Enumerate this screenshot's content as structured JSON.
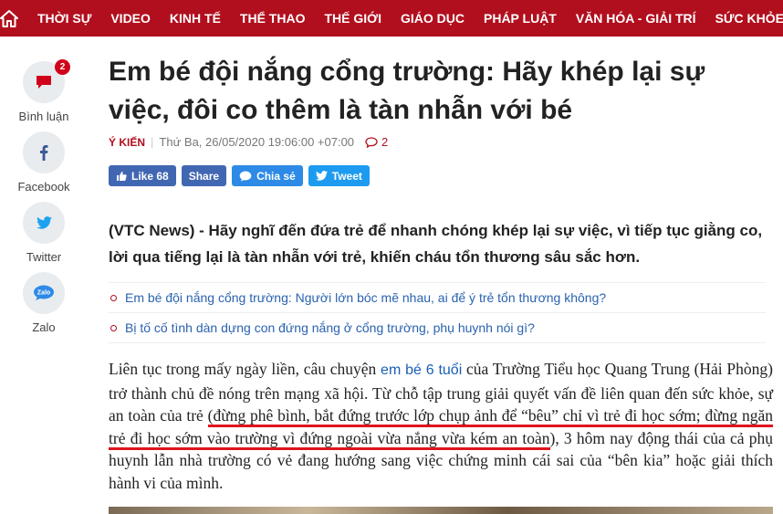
{
  "nav": {
    "items": [
      "THỜI SỰ",
      "VIDEO",
      "KINH TẾ",
      "THỂ THAO",
      "THẾ GIỚI",
      "GIÁO DỤC",
      "PHÁP LUẬT",
      "VĂN HÓA - GIẢI TRÍ",
      "SỨC KHỎE"
    ]
  },
  "rail": {
    "comments_label": "Bình luận",
    "comments_count": "2",
    "facebook_label": "Facebook",
    "twitter_label": "Twitter",
    "zalo_label": "Zalo",
    "zalo_icon_text": "Zalo"
  },
  "article": {
    "title": "Em bé đội nắng cổng trường: Hãy khép lại sự việc, đôi co thêm là tàn nhẫn với bé",
    "category": "Ý KIẾN",
    "datetime": "Thứ Ba, 26/05/2020 19:06:00 +07:00",
    "comment_count": "2",
    "lead": "(VTC News) - Hãy nghĩ đến đứa trẻ để nhanh chóng khép lại sự việc, vì tiếp tục giằng co, lời qua tiếng lại là tàn nhẫn với trẻ, khiến cháu tổn thương sâu sắc hơn.",
    "related": [
      "Em bé đội nắng cổng trường: Người lớn bóc mẽ nhau, ai để ý trẻ tổn thương không?",
      "Bị tố cố tình dàn dựng con đứng nắng ở cổng trường, phụ huynh nói gì?"
    ],
    "body_1": "Liên tục trong mấy ngày liền, câu chuyện ",
    "body_link": "em bé 6 tuổi",
    "body_2": " của Trường Tiểu học Quang Trung (Hải Phòng) trở thành chủ đề nóng trên mạng xã hội. Từ chỗ tập trung giải quyết vấn đề liên quan đến sức khỏe, sự an toàn của trẻ ",
    "body_highlight": "(đừng phê bình, bắt đứng trước lớp chụp ảnh để “bêu” chỉ vì trẻ đi học sớm; đừng ngăn trẻ đi học sớm vào trường vì đứng ngoài vừa nắng vừa kém an toàn",
    "body_3": "), 3 hôm nay động thái của cả phụ huynh lẫn nhà trường có vẻ đang hướng sang việc chứng minh cái sai của “bên kia” hoặc giải thích hành vi của mình."
  },
  "share": {
    "like_label": "Like 68",
    "share_label": "Share",
    "zalo_label": "Chia sẻ",
    "tweet_label": "Tweet"
  },
  "colors": {
    "brand": "#b20f1e",
    "link": "#2a63b0",
    "facebook": "#4267b2",
    "zalo": "#2d8ae6",
    "twitter": "#1d9bf0",
    "underline": "#e0141e"
  }
}
